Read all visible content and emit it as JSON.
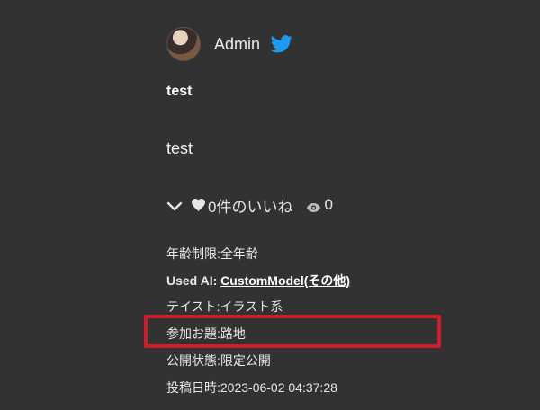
{
  "author": {
    "name": "Admin",
    "avatar_icon": "avatar",
    "social_icon": "twitter-icon",
    "social_color": "#1d9bf0"
  },
  "post": {
    "title": "test",
    "body": "test"
  },
  "actions": {
    "likes_text": "0件のいいね",
    "views": "0"
  },
  "meta": {
    "age_rating": "年齢制限:全年齢",
    "used_ai_label": "Used AI:",
    "used_ai_value": "CustomModel(その他)",
    "taste": "テイスト:イラスト系",
    "theme": "参加お題:路地",
    "visibility": "公開状態:限定公開",
    "posted_at": "投稿日時:2023-06-02 04:37:28"
  },
  "highlight_color": "#d11d2b"
}
